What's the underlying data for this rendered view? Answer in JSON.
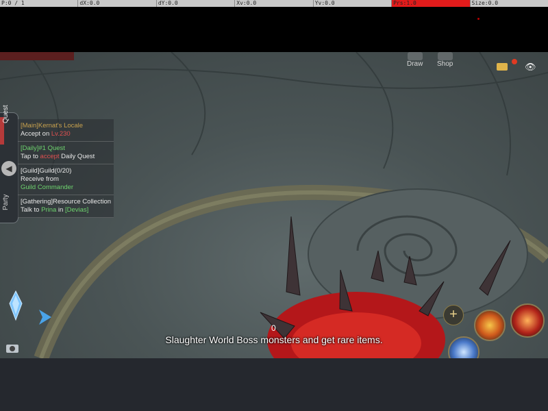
{
  "debug_overlay": {
    "pointer": "P:0 / 1",
    "dx": "dX:0.0",
    "dy": "dY:0.0",
    "xv": "Xv:0.0",
    "yv": "Yv:0.0",
    "prs": "Prs:1.0",
    "size": "Size:0.0",
    "highlight_color": "#e21b1b"
  },
  "top_menu": {
    "draw_label": "Draw",
    "shop_label": "Shop",
    "mail_icon": "mail-icon",
    "eye_icon": "eye-icon"
  },
  "side_tabs": {
    "quest_label": "Quest",
    "party_label": "Party"
  },
  "quests": [
    {
      "title": "[Main]Kernat's Locale",
      "line1_prefix": "Accept on ",
      "line1_highlight": "Lv.230",
      "line1_suffix": ""
    },
    {
      "title": "[Daily]#1 Quest",
      "line1_prefix": "Tap to ",
      "line1_highlight": "accept",
      "line1_suffix": " Daily Quest"
    },
    {
      "title": "[Guild]Guild(0/20)",
      "line1_prefix": "Receive from",
      "line2": "Guild Commander"
    },
    {
      "title": "[Gathering]Resource Collection",
      "line1_prefix": "Talk to ",
      "line1_highlight": "Prina",
      "line1_suffix": " in ",
      "line1_tail": "[Devias]"
    }
  ],
  "hud": {
    "counter": "0",
    "hint": "Slaughter World Boss monsters and get rare items.",
    "plus": "+"
  },
  "colors": {
    "quest_title_main": "#c9a24e",
    "quest_title_daily": "#6ed36e",
    "highlight": "#e05050"
  }
}
